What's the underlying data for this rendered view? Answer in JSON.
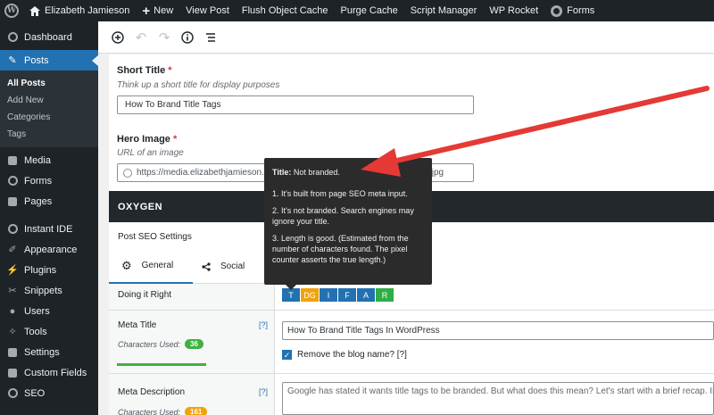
{
  "admin_bar": {
    "site_name": "Elizabeth Jamieson",
    "new_label": "New",
    "view_post": "View Post",
    "flush_cache": "Flush Object Cache",
    "purge_cache": "Purge Cache",
    "script_manager": "Script Manager",
    "wp_rocket": "WP Rocket",
    "forms": "Forms"
  },
  "sidebar": {
    "items": [
      {
        "label": "Dashboard",
        "icon": "dashboard-icon"
      },
      {
        "label": "Posts",
        "icon": "pin-icon",
        "active": true
      },
      {
        "label": "Media",
        "icon": "media-icon"
      },
      {
        "label": "Forms",
        "icon": "forms-icon"
      },
      {
        "label": "Pages",
        "icon": "pages-icon"
      },
      {
        "label": "Instant IDE",
        "icon": "instant-ide-icon"
      },
      {
        "label": "Appearance",
        "icon": "brush-icon"
      },
      {
        "label": "Plugins",
        "icon": "plugin-icon"
      },
      {
        "label": "Snippets",
        "icon": "snippets-icon"
      },
      {
        "label": "Users",
        "icon": "users-icon"
      },
      {
        "label": "Tools",
        "icon": "wrench-icon"
      },
      {
        "label": "Settings",
        "icon": "settings-icon"
      },
      {
        "label": "Custom Fields",
        "icon": "custom-fields-icon"
      },
      {
        "label": "SEO",
        "icon": "seo-icon"
      }
    ],
    "submenu": [
      "All Posts",
      "Add New",
      "Categories",
      "Tags"
    ]
  },
  "editor": {
    "short_title_label": "Short Title",
    "required_mark": "*",
    "short_title_desc": "Think up a short title for display purposes",
    "short_title_value": "How To Brand Title Tags",
    "hero_image_label": "Hero Image",
    "hero_image_desc": "URL of an image",
    "hero_image_value": "https://media.elizabethjamieson.com",
    "hero_image_suffix": ".jpg"
  },
  "oxygen": {
    "title": "OXYGEN",
    "seo_settings_title": "Post SEO Settings",
    "tabs": [
      "General",
      "Social"
    ],
    "doing_it_right": "Doing it Right",
    "badges": [
      {
        "label": "T",
        "color": "#2271b1"
      },
      {
        "label": "DG",
        "color": "#f0a30a"
      },
      {
        "label": "I",
        "color": "#2271b1"
      },
      {
        "label": "F",
        "color": "#2271b1"
      },
      {
        "label": "A",
        "color": "#2271b1"
      },
      {
        "label": "R",
        "color": "#2eae45"
      }
    ],
    "meta_title_label": "Meta Title",
    "help_mark": "[?]",
    "chars_used_label": "Characters Used:",
    "meta_title_count": "36",
    "meta_title_value": "How To Brand Title Tags In WordPress",
    "remove_blog_name": "Remove the blog name? [?]",
    "meta_desc_label": "Meta Description",
    "meta_desc_count": "161",
    "meta_desc_value": "Google has stated it wants title tags to be branded. But what does this mean? Let's start with a brief recap. In the p"
  },
  "tooltip": {
    "head_bold": "Title:",
    "head_rest": "Not branded.",
    "items": [
      "1. It's built from page SEO meta input.",
      "2. It's not branded. Search engines may ignore your title.",
      "3. Length is good. (Estimated from the number of characters found. The pixel counter asserts the true length.)"
    ]
  },
  "colors": {
    "accent": "#2271b1",
    "admin_dark": "#1d2327",
    "annotation_arrow": "#e53935",
    "green_pill": "#3fb13f",
    "orange_pill": "#f0a30a"
  }
}
